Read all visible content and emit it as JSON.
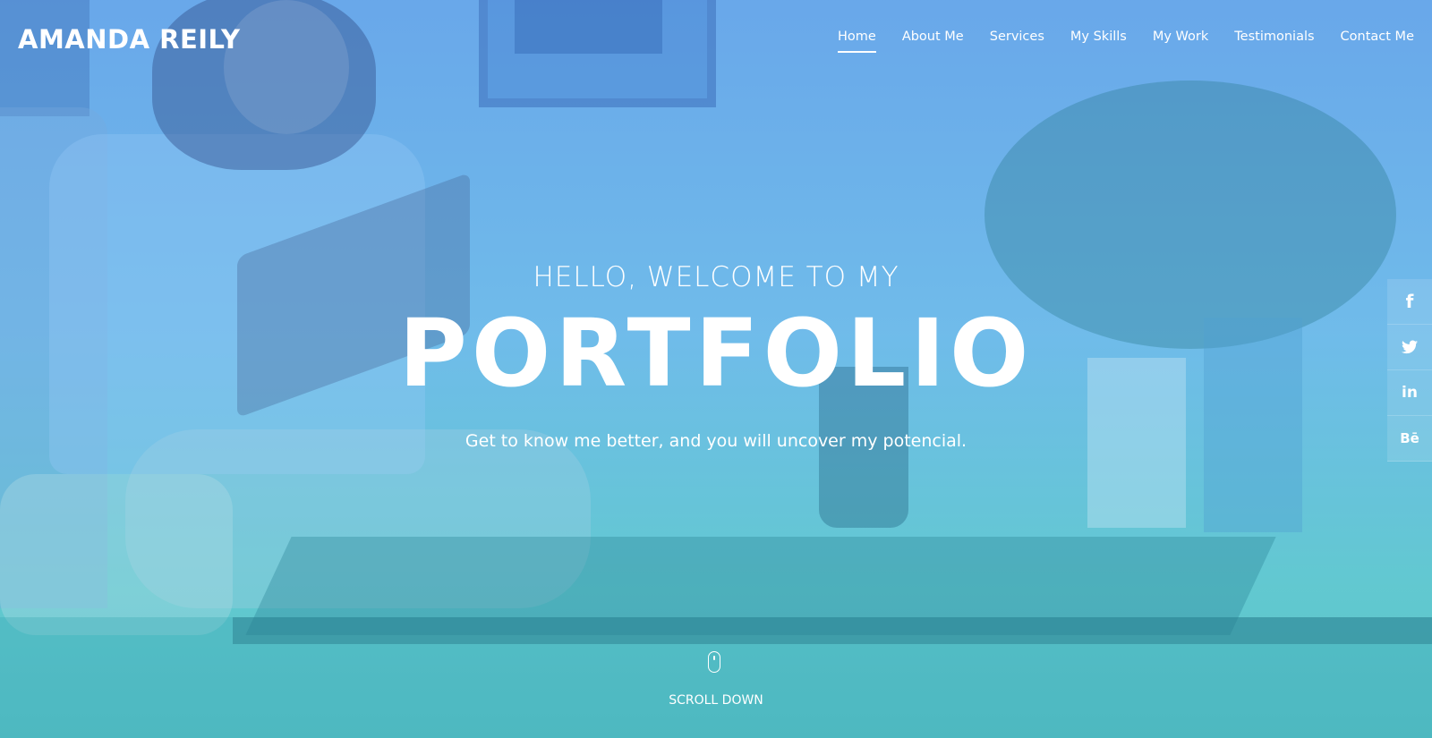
{
  "header": {
    "logo": "AMANDA REILY",
    "nav": [
      {
        "label": "Home",
        "active": true
      },
      {
        "label": "About Me",
        "active": false
      },
      {
        "label": "Services",
        "active": false
      },
      {
        "label": "My Skills",
        "active": false
      },
      {
        "label": "My Work",
        "active": false
      },
      {
        "label": "Testimonials",
        "active": false
      },
      {
        "label": "Contact Me",
        "active": false
      }
    ]
  },
  "hero": {
    "welcome": "HELLO, WELCOME TO MY",
    "title": "PORTFOLIO",
    "tagline": "Get to know me better, and you will uncover my potencial.",
    "scroll_label": "SCROLL DOWN"
  },
  "social": [
    {
      "icon": "facebook-icon",
      "glyph": "f"
    },
    {
      "icon": "twitter-icon",
      "glyph": ""
    },
    {
      "icon": "linkedin-icon",
      "glyph": "in"
    },
    {
      "icon": "behance-icon",
      "glyph": "Bē"
    }
  ],
  "colors": {
    "overlay_top": "#5ca0e8",
    "overlay_bottom": "#4ebec4",
    "text": "#ffffff"
  }
}
